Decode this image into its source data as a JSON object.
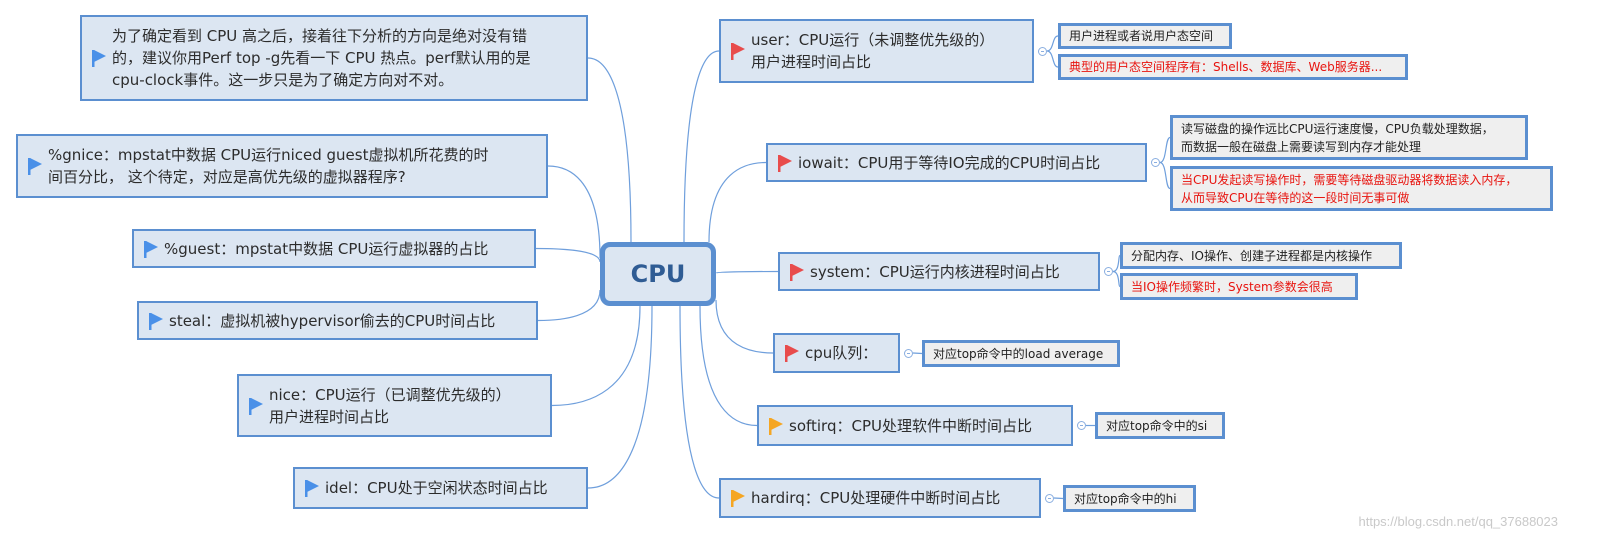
{
  "center": {
    "label": "CPU"
  },
  "colors": {
    "accent": "#5b8fd0",
    "node_fill": "#dce6f2",
    "sub_fill": "#efefef",
    "flag_blue": "#4a90e8",
    "flag_red": "#e84c4c",
    "flag_orange": "#f5a623",
    "red_text": "#e8140f"
  },
  "left_nodes": [
    {
      "id": "perf-note",
      "flag": "blue",
      "text": "为了确定看到 CPU 高之后，接着往下分析的方向是绝对没有错\n的，建议你用Perf top -g先看一下 CPU 热点。perf默认用的是\ncpu-clock事件。这一步只是为了确定方向对不对。"
    },
    {
      "id": "gnice",
      "flag": "blue",
      "text": "%gnice：mpstat中数据  CPU运行niced guest虚拟机所花费的时\n间百分比，  这个待定，对应是高优先级的虚拟器程序?"
    },
    {
      "id": "guest",
      "flag": "blue",
      "text": "%guest：mpstat中数据  CPU运行虚拟器的占比"
    },
    {
      "id": "steal",
      "flag": "blue",
      "text": "steal：虚拟机被hypervisor偷去的CPU时间占比"
    },
    {
      "id": "nice",
      "flag": "blue",
      "text": "nice：CPU运行（已调整优先级的）\n用户进程时间占比"
    },
    {
      "id": "idel",
      "flag": "blue",
      "text": "idel：CPU处于空闲状态时间占比"
    }
  ],
  "right_nodes": [
    {
      "id": "user",
      "flag": "red",
      "text": "user：CPU运行（未调整优先级的）\n用户进程时间占比",
      "children": [
        {
          "text": "用户进程或者说用户态空间",
          "red": false
        },
        {
          "text": "典型的用户态空间程序有：Shells、数据库、Web服务器...",
          "red": true
        }
      ]
    },
    {
      "id": "iowait",
      "flag": "red",
      "text": "iowait：CPU用于等待IO完成的CPU时间占比",
      "children": [
        {
          "text": "读写磁盘的操作远比CPU运行速度慢，CPU负载处理数据，\n而数据一般在磁盘上需要读写到内存才能处理",
          "red": false
        },
        {
          "text": "当CPU发起读写操作时，需要等待磁盘驱动器将数据读入内存，\n从而导致CPU在等待的这一段时间无事可做",
          "red": true
        }
      ]
    },
    {
      "id": "system",
      "flag": "red",
      "text": "system：CPU运行内核进程时间占比",
      "children": [
        {
          "text": "分配内存、IO操作、创建子进程都是内核操作",
          "red": false
        },
        {
          "text": "当IO操作频繁时，System参数会很高",
          "red": true
        }
      ]
    },
    {
      "id": "cpu-queue",
      "flag": "red",
      "text": "cpu队列：",
      "children": [
        {
          "text": "对应top命令中的load average",
          "red": false
        }
      ]
    },
    {
      "id": "softirq",
      "flag": "orange",
      "text": "softirq：CPU处理软件中断时间占比",
      "children": [
        {
          "text": "对应top命令中的si",
          "red": false
        }
      ]
    },
    {
      "id": "hardirq",
      "flag": "orange",
      "text": "hardirq：CPU处理硬件中断时间占比",
      "children": [
        {
          "text": "对应top命令中的hi",
          "red": false
        }
      ]
    }
  ],
  "watermark": "https://blog.csdn.net/qq_37688023"
}
